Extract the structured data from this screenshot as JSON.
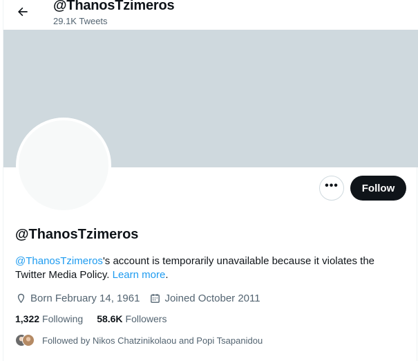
{
  "header": {
    "title": "@ThanosTzimeros",
    "tweet_count": "29.1K Tweets"
  },
  "profile": {
    "display_name": "@ThanosTzimeros",
    "notice": {
      "handle_link": "@ThanosTzimeros",
      "text": "'s account is temporarily unavailable because it violates the Twitter Media Policy.",
      "learn_more": "Learn more",
      "end": "."
    },
    "born": "Born February 14, 1961",
    "joined": "Joined October 2011",
    "following_count": "1,322",
    "following_label": "Following",
    "followers_count": "58.6K",
    "followers_label": "Followers",
    "followed_by": "Followed by Nikos Chatzinikolaou and Popi Tsapanidou"
  },
  "actions": {
    "more": "•••",
    "follow": "Follow"
  },
  "colors": {
    "banner": "#cfd9de",
    "link": "#1d9bf0",
    "follow_bg": "#0f1419",
    "secondary_text": "#536471"
  },
  "icons": [
    "back-arrow-icon",
    "more-icon",
    "birthday-icon",
    "calendar-icon"
  ]
}
